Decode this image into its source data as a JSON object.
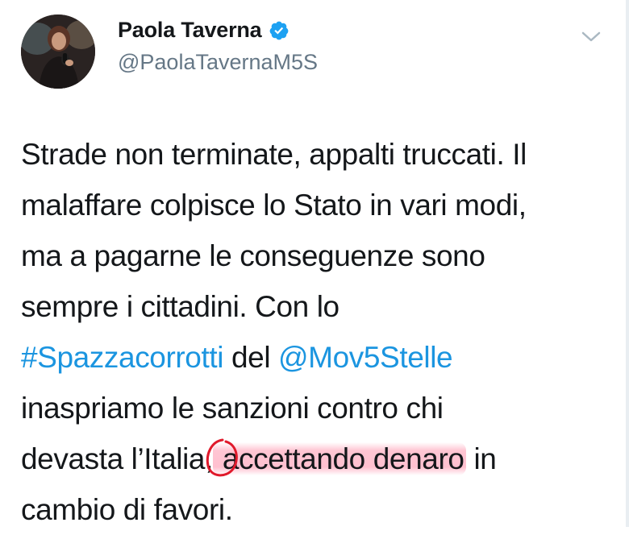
{
  "tweet": {
    "author": {
      "display_name": "Paola Taverna",
      "handle": "@PaolaTavernaM5S",
      "verified_icon": "verified-badge-icon",
      "avatar": "profile-avatar"
    },
    "menu_icon": "chevron-down-icon",
    "lines": [
      {
        "text": "Strade non terminate, appalti truccati. Il"
      },
      {
        "text": "malaffare colpisce lo Stato in vari modi,"
      },
      {
        "text": "ma a pagarne le conseguenze sono"
      },
      {
        "text": "sempre i cittadini. Con lo"
      }
    ],
    "line5": {
      "hashtag": "#Spazzacorrotti",
      "mid": " del ",
      "mention": "@Mov5Stelle"
    },
    "line6": "inaspriamo le sanzioni contro chi",
    "line7": {
      "before": "devasta l’Italia,",
      "highlighted": " accettando denaro",
      "after": " in"
    },
    "line8": "cambio di favori.",
    "colors": {
      "link": "#1b95e0",
      "verified": "#1da1f2",
      "highlight": "#ff96af",
      "annotation_circle": "#e0192b"
    }
  }
}
